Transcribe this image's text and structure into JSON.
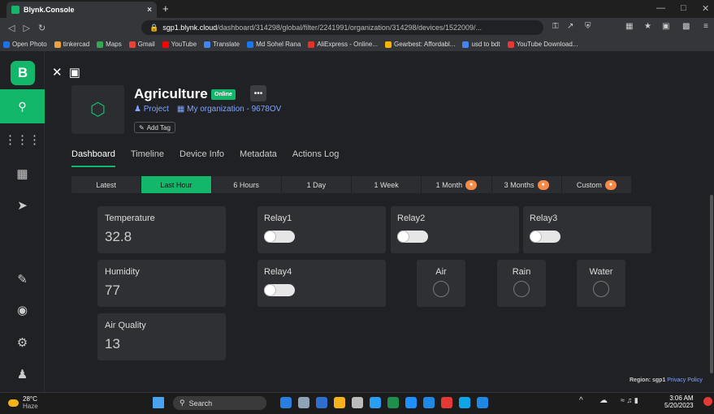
{
  "browser": {
    "tab_title": "Blynk.Console",
    "tab_close": "×",
    "new_tab": "+",
    "url_domain": "sgp1.blynk.cloud",
    "url_path": "/dashboard/314298/global/filter/2241991/organization/314298/devices/1522009/...",
    "bookmarks": [
      "Open Photo",
      "tinkercad",
      "Maps",
      "Gmail",
      "YouTube",
      "Translate",
      "Md Sohel Rana",
      "AliExpress - Online...",
      "Gearbest: Affordabl...",
      "usd to bdt",
      "YouTube Download..."
    ],
    "bookmark_colors": [
      "#1a73e8",
      "#e8a33d",
      "#34a853",
      "#ea4335",
      "#ff0000",
      "#4285f4",
      "#1877f2",
      "#e43225",
      "#f7b500",
      "#4285f4",
      "#e53935"
    ]
  },
  "sidebar": {
    "logo": "B",
    "icons": [
      "search-icon",
      "grid-icon",
      "building-icon",
      "send-icon",
      "megaphone-icon",
      "help-icon",
      "settings-icon",
      "user-icon"
    ]
  },
  "device": {
    "name": "Agriculture",
    "status": "Online",
    "more": "•••",
    "project": "Project",
    "organization": "My organization - 9678OV",
    "add_tag": "Add Tag"
  },
  "tabs": [
    "Dashboard",
    "Timeline",
    "Device Info",
    "Metadata",
    "Actions Log"
  ],
  "active_tab": "Dashboard",
  "time_ranges": [
    {
      "label": "Latest",
      "locked": false,
      "active": false
    },
    {
      "label": "Last Hour",
      "locked": false,
      "active": true
    },
    {
      "label": "6 Hours",
      "locked": false,
      "active": false
    },
    {
      "label": "1 Day",
      "locked": false,
      "active": false
    },
    {
      "label": "1 Week",
      "locked": false,
      "active": false
    },
    {
      "label": "1 Month",
      "locked": true,
      "active": false
    },
    {
      "label": "3 Months",
      "locked": true,
      "active": false
    },
    {
      "label": "Custom",
      "locked": true,
      "active": false
    }
  ],
  "widgets": {
    "temperature": {
      "label": "Temperature",
      "value": "32.8"
    },
    "humidity": {
      "label": "Humidity",
      "value": "77"
    },
    "air_quality": {
      "label": "Air Quality",
      "value": "13"
    },
    "relay1": {
      "label": "Relay1",
      "on": false
    },
    "relay2": {
      "label": "Relay2",
      "on": false
    },
    "relay3": {
      "label": "Relay3",
      "on": false
    },
    "relay4": {
      "label": "Relay4",
      "on": false
    },
    "air": {
      "label": "Air",
      "on": false
    },
    "rain": {
      "label": "Rain",
      "on": false
    },
    "water": {
      "label": "Water",
      "on": false
    }
  },
  "footer": {
    "region_label": "Region: sgp1",
    "privacy": "Privacy Policy"
  },
  "taskbar": {
    "temp": "28°C",
    "condition": "Haze",
    "search": "Search",
    "time": "3:06 AM",
    "date": "5/20/2023",
    "app_colors": [
      "#2a7de1",
      "#8fa3b8",
      "#2f6fd0",
      "#f5b21c",
      "#bbb",
      "#2a9df4",
      "#1f8f4e",
      "#1e90ff",
      "#1e88e5",
      "#e53935",
      "#0ea5e9",
      "#1e88e5"
    ]
  },
  "accent": "#12b76a"
}
